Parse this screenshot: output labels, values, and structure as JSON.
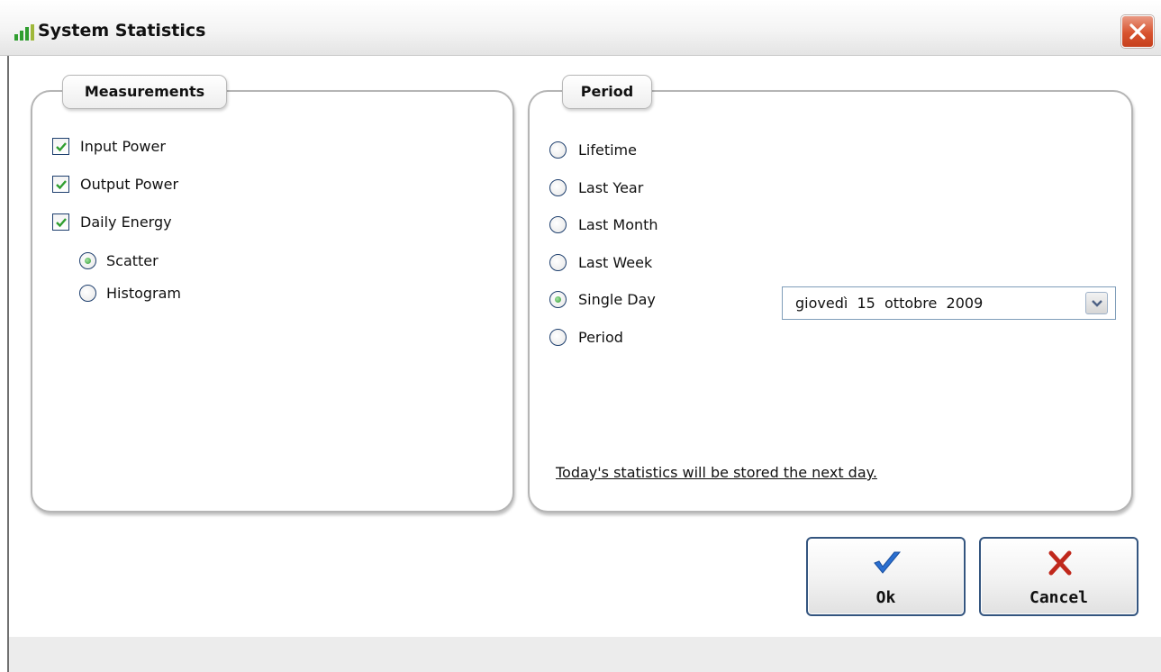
{
  "window": {
    "title": "System Statistics",
    "icon": "bar-chart-icon",
    "close_icon": "close-icon"
  },
  "measurements": {
    "legend": "Measurements",
    "checkboxes": [
      {
        "label": "Input Power",
        "checked": true
      },
      {
        "label": "Output Power",
        "checked": true
      },
      {
        "label": "Daily Energy",
        "checked": true
      }
    ],
    "chart_type": [
      {
        "label": "Scatter",
        "selected": true
      },
      {
        "label": "Histogram",
        "selected": false
      }
    ]
  },
  "period": {
    "legend": "Period",
    "options": [
      {
        "label": "Lifetime",
        "selected": false
      },
      {
        "label": "Last Year",
        "selected": false
      },
      {
        "label": "Last Month",
        "selected": false
      },
      {
        "label": "Last Week",
        "selected": false
      },
      {
        "label": "Single Day",
        "selected": true
      },
      {
        "label": "Period",
        "selected": false
      }
    ],
    "date_value": "giovedì  15  ottobre  2009",
    "note": "Today's statistics will be stored the next day."
  },
  "buttons": {
    "ok_label": "Ok",
    "ok_icon": "checkmark-icon",
    "cancel_label": "Cancel",
    "cancel_icon": "x-mark-icon"
  },
  "colors": {
    "check_accent": "#2f9e2f",
    "ok_icon": "#2a6fd1",
    "cancel_icon": "#c0281c",
    "close_button": "#d8532f",
    "button_border": "#34557f"
  }
}
